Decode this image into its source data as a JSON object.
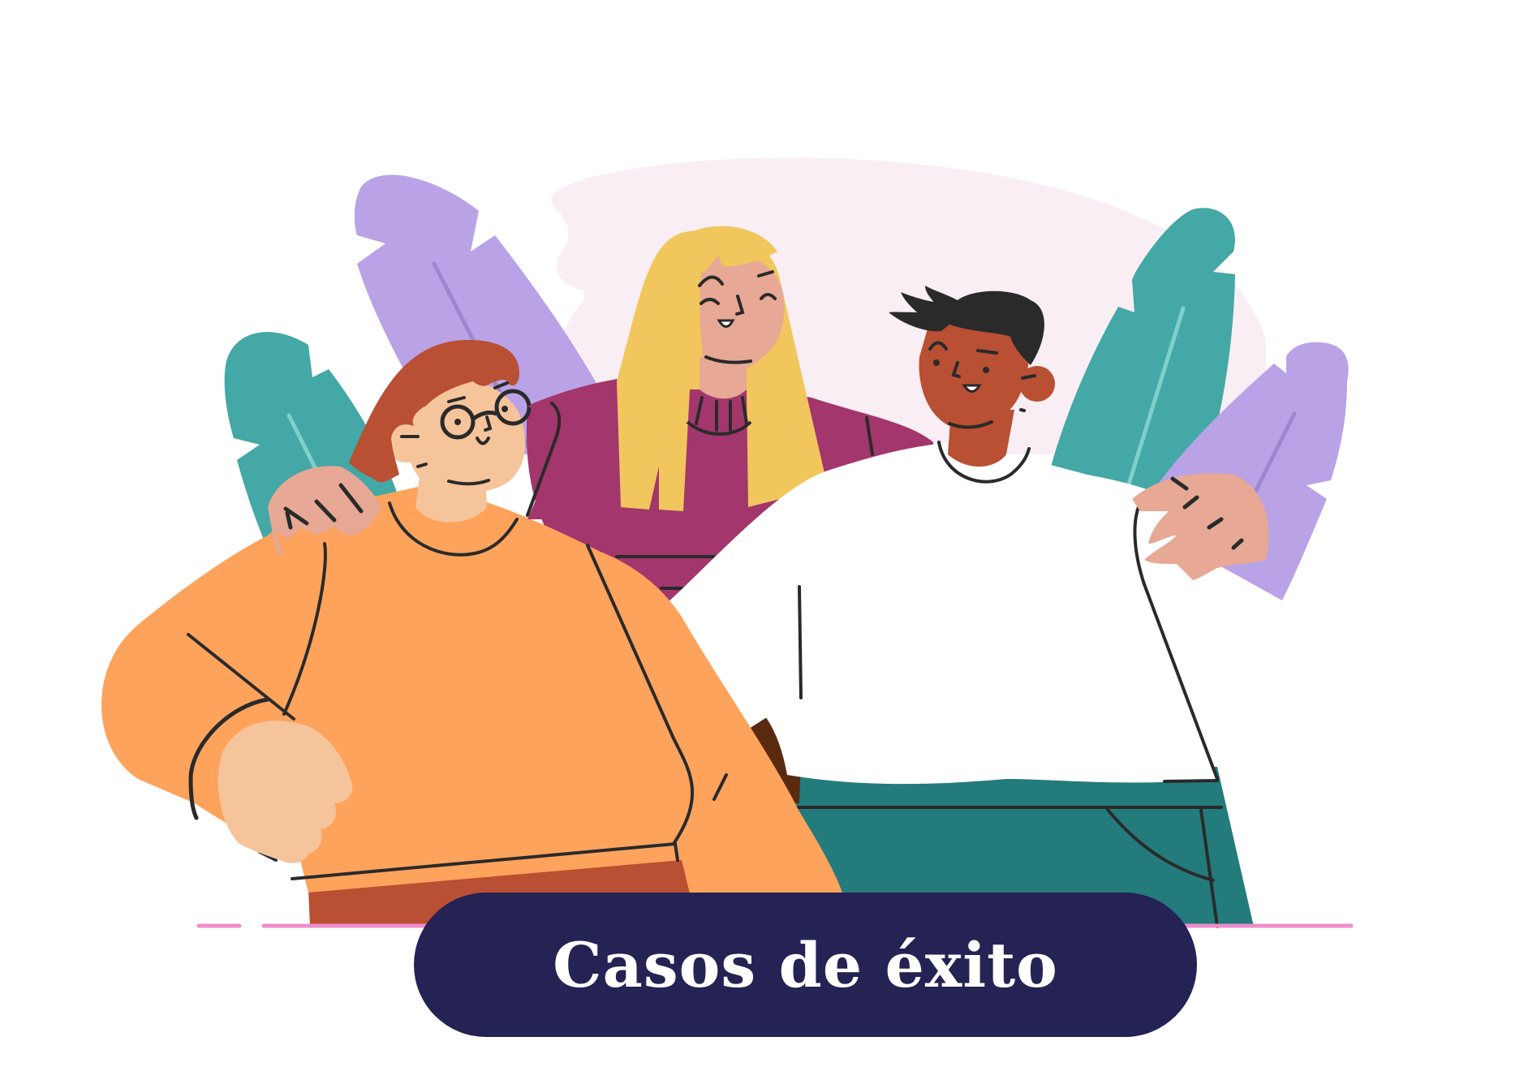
{
  "banner": {
    "label": "Casos de éxito"
  },
  "colors": {
    "background": "#ffffff",
    "pill": "#252254",
    "pill_text": "#ffffff",
    "cloud": "#f9eef3",
    "leaf_purple": "#b9a3e6",
    "leaf_teal": "#43a8a6",
    "orange_shirt": "#fda35c",
    "rust": "#b94f33",
    "magenta_shirt": "#a3366c",
    "blonde_hair": "#f1c65c",
    "white_shirt": "#ffffff",
    "teal_pants": "#237b7c",
    "skin_light": "#f5c49b",
    "skin_pink": "#e7a895",
    "skin_dark": "#b94f33",
    "line": "#2a2a2a",
    "ground_line": "#ef8ccb"
  },
  "icons": [
    "plant-leaf-icon",
    "person-illustration-icon"
  ]
}
